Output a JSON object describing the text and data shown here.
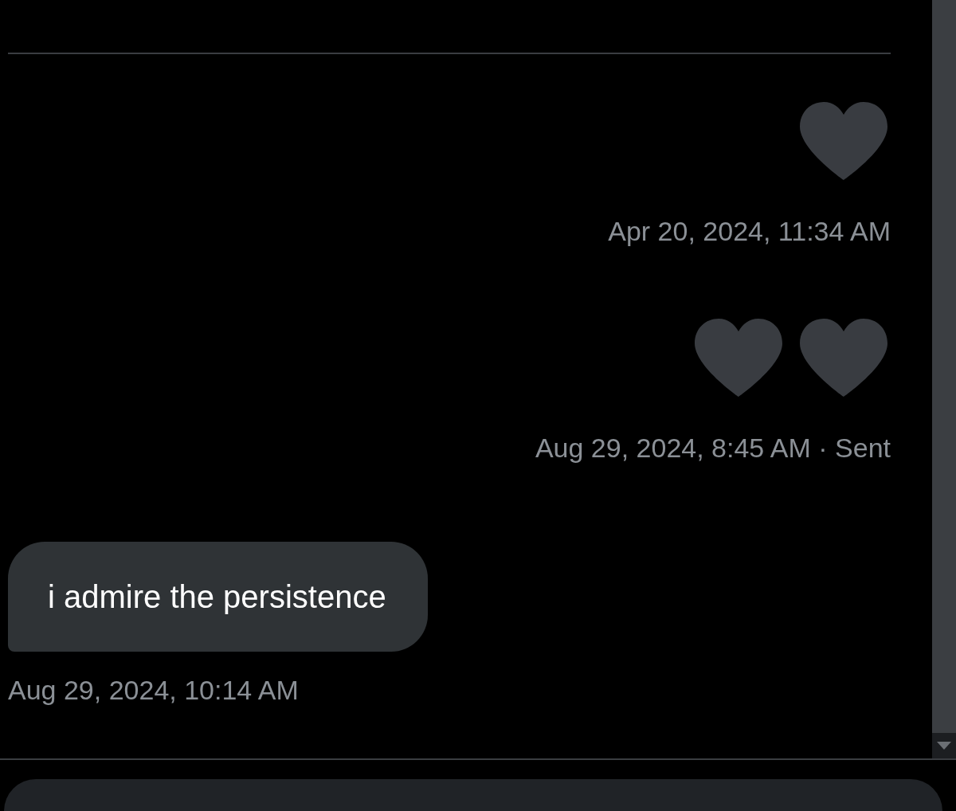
{
  "messages": [
    {
      "kind": "sent",
      "hearts": [
        {
          "kind": "heart"
        }
      ],
      "time": "Apr 20, 2024, 11:34 AM"
    },
    {
      "kind": "sent",
      "hearts": [
        {
          "kind": "heart"
        },
        {
          "kind": "heart"
        }
      ],
      "time": "Aug 29, 2024, 8:45 AM · Sent"
    },
    {
      "kind": "received",
      "text": "i admire the persistence",
      "time": "Aug 29, 2024, 10:14 AM"
    }
  ]
}
